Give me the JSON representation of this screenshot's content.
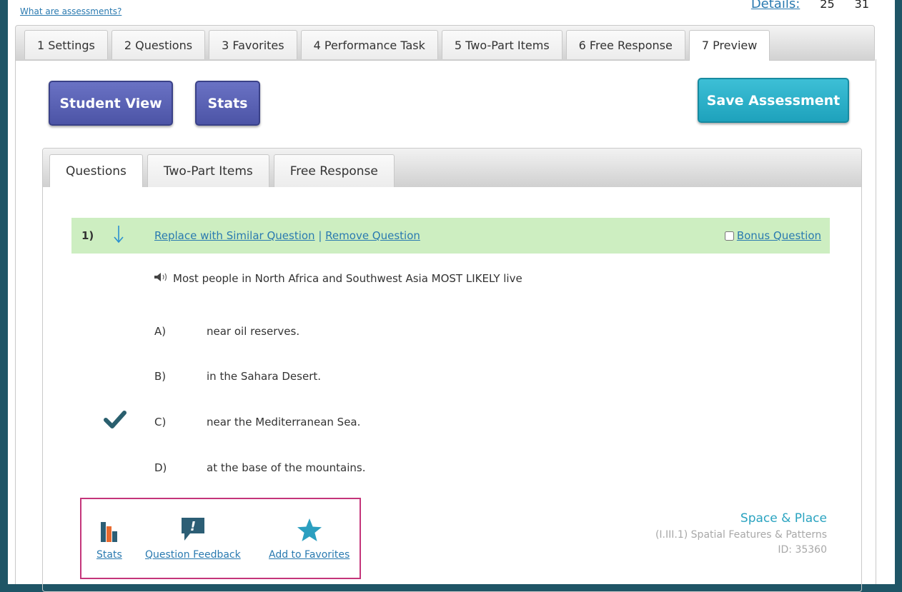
{
  "header": {
    "help_link": "What are assessments?",
    "details_label": "Details:",
    "details_values": [
      "25",
      "31"
    ]
  },
  "top_tabs": [
    {
      "label": "1 Settings"
    },
    {
      "label": "2 Questions"
    },
    {
      "label": "3 Favorites"
    },
    {
      "label": "4 Performance Task"
    },
    {
      "label": "5 Two-Part Items"
    },
    {
      "label": "6 Free Response"
    },
    {
      "label": "7 Preview",
      "active": true
    }
  ],
  "buttons": {
    "student_view": "Student View",
    "stats": "Stats",
    "save": "Save Assessment"
  },
  "inner_tabs": [
    {
      "label": "Questions",
      "active": true
    },
    {
      "label": "Two-Part Items"
    },
    {
      "label": "Free Response"
    }
  ],
  "question": {
    "number": "1)",
    "replace_link": "Replace with Similar Question",
    "separator": "|",
    "remove_link": "Remove Question",
    "bonus_label": "Bonus Question",
    "bonus_checked": false,
    "stem": "Most people in North Africa and Southwest Asia MOST LIKELY live",
    "choices": [
      {
        "letter": "A)",
        "text": "near oil reserves."
      },
      {
        "letter": "B)",
        "text": "in the Sahara Desert."
      },
      {
        "letter": "C)",
        "text": "near the Mediterranean Sea.",
        "correct": true
      },
      {
        "letter": "D)",
        "text": "at the base of the mountains."
      }
    ]
  },
  "tools": {
    "stats": "Stats",
    "feedback": "Question Feedback",
    "favorites": "Add to Favorites"
  },
  "meta": {
    "category": "Space & Place",
    "standard": "(I.III.1) Spatial Features & Patterns",
    "id": "ID: 35360"
  },
  "colors": {
    "button_blue": "#5a62b6",
    "button_teal": "#2bb0c8",
    "question_bar": "#cdeec1",
    "link": "#2a7ab0",
    "highlight_box": "#c4357a",
    "check": "#2a5f6e"
  }
}
